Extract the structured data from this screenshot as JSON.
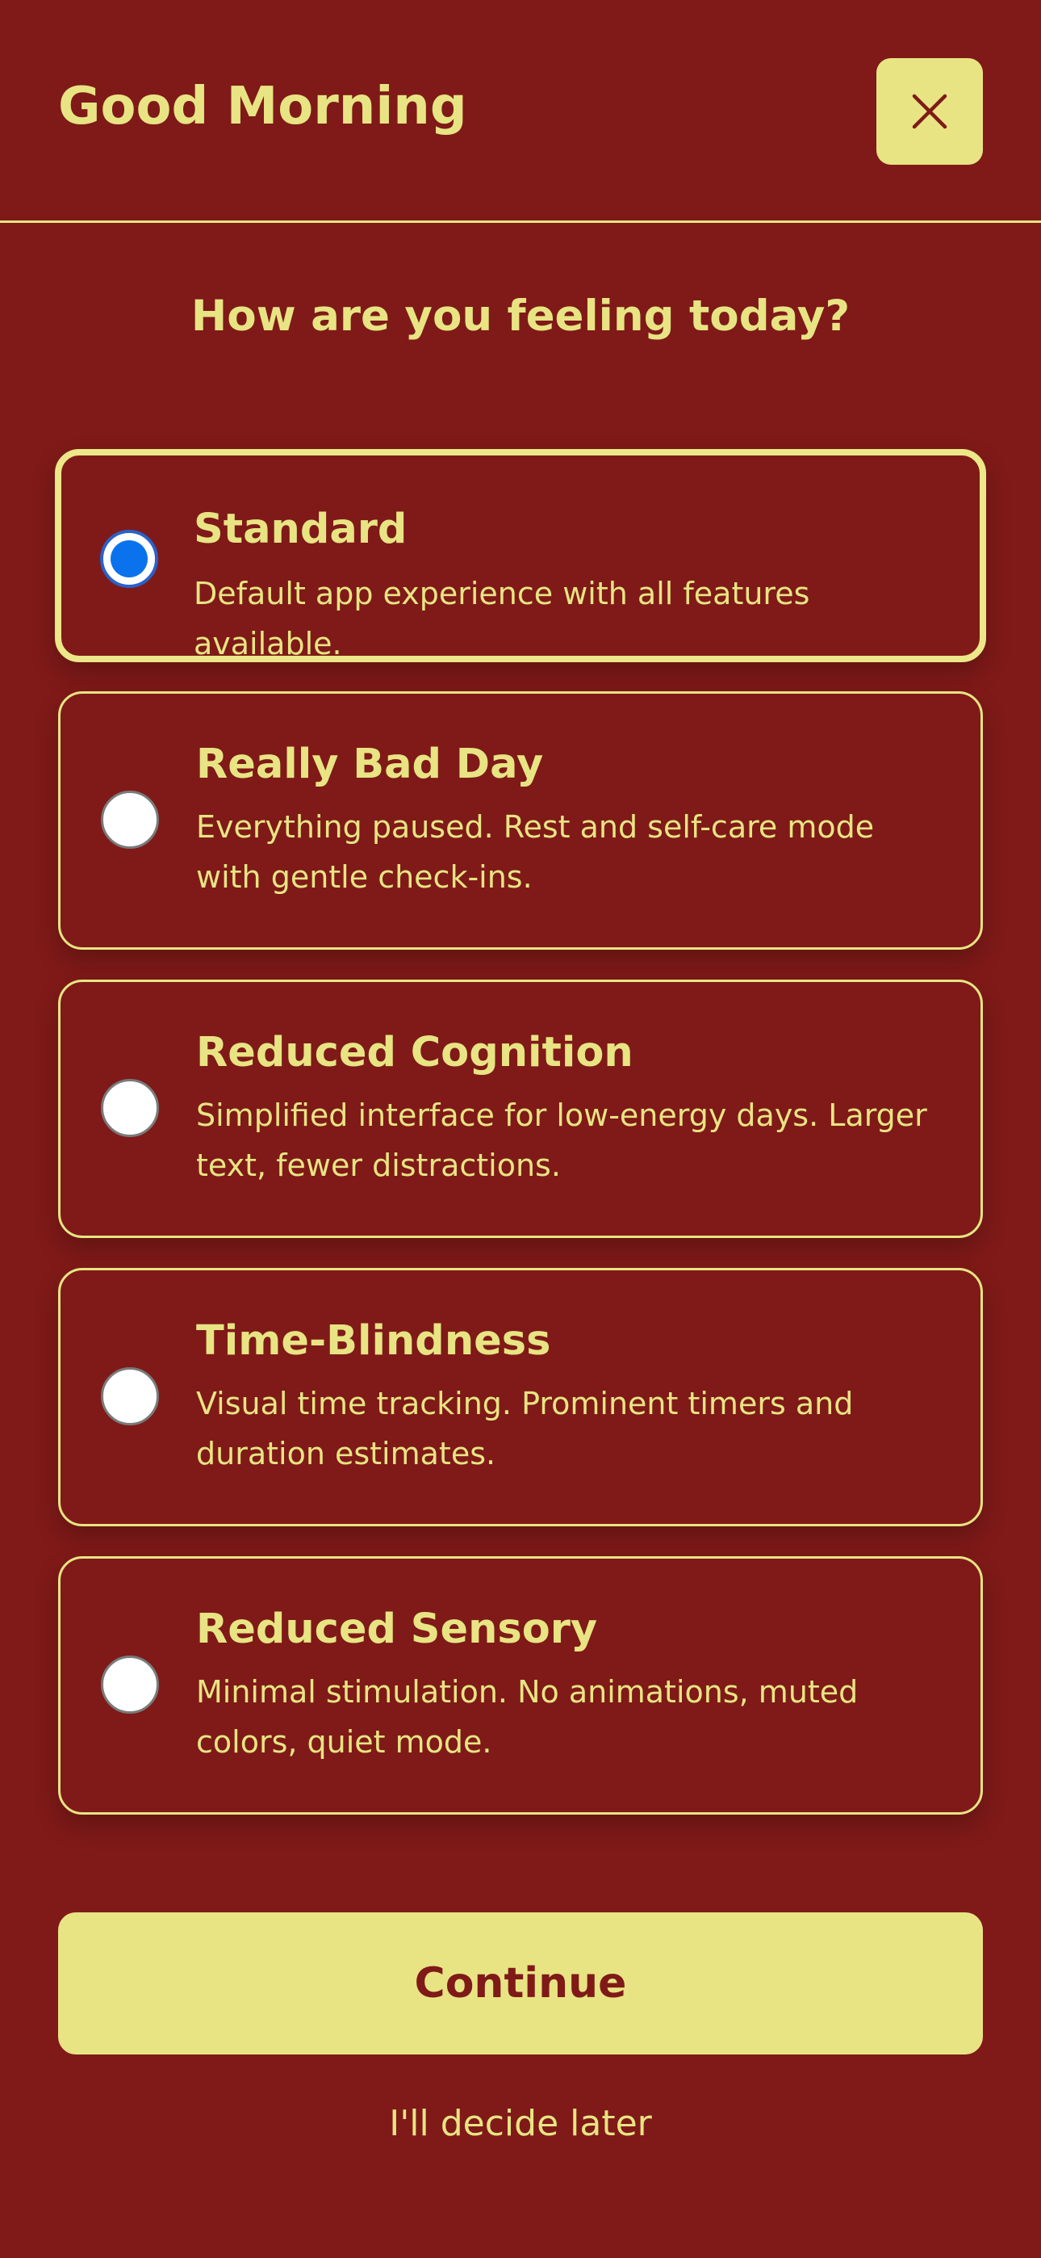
{
  "header": {
    "title": "Good Morning",
    "close_icon": "close-icon"
  },
  "question": "How are you feeling today?",
  "options": [
    {
      "title": "Standard",
      "description": "Default app experience with all features available.",
      "selected": true
    },
    {
      "title": "Really Bad Day",
      "description": "Everything paused. Rest and self-care mode with gentle check-ins.",
      "selected": false
    },
    {
      "title": "Reduced Cognition",
      "description": "Simplified interface for low-energy days. Larger text, fewer distractions.",
      "selected": false
    },
    {
      "title": "Time-Blindness",
      "description": "Visual time tracking. Prominent timers and duration estimates.",
      "selected": false
    },
    {
      "title": "Reduced Sensory",
      "description": "Minimal stimulation. No animations, muted colors, quiet mode.",
      "selected": false
    }
  ],
  "actions": {
    "continue_label": "Continue",
    "later_label": "I'll decide later"
  },
  "colors": {
    "background": "#7f1a18",
    "accent": "#e8e483",
    "radio_selected": "#0a72ec"
  }
}
